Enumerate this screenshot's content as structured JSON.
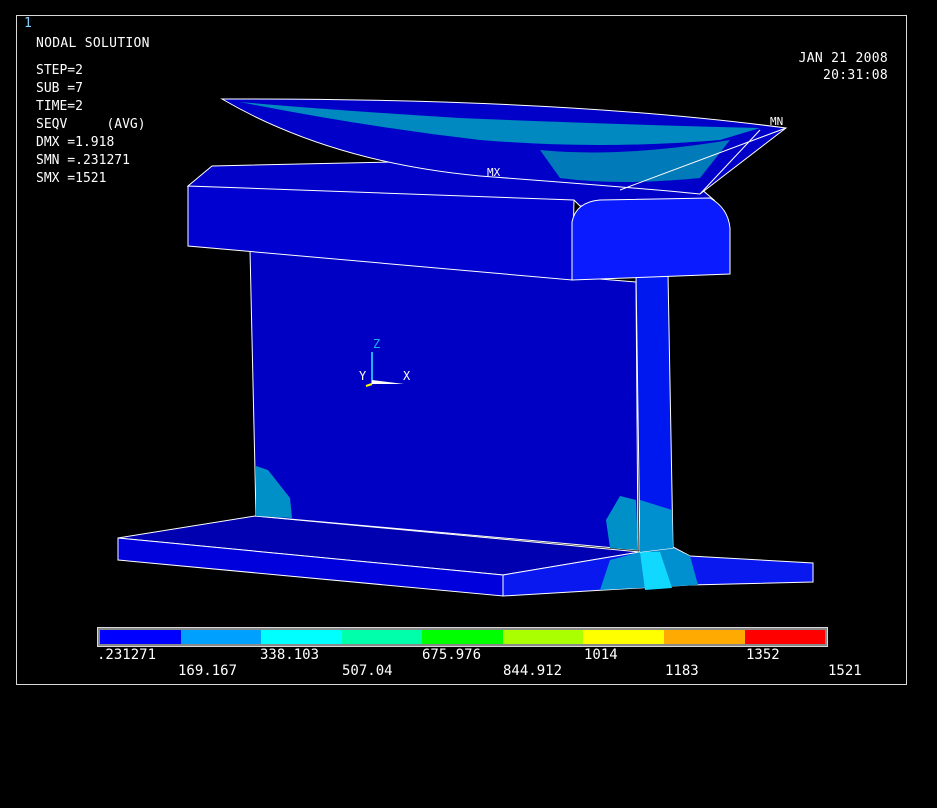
{
  "window_number": "1",
  "title": "NODAL SOLUTION",
  "info_lines": [
    "STEP=2",
    "SUB =7",
    "TIME=2",
    "SEQV     (AVG)",
    "DMX =1.918",
    "SMN =.231271",
    "SMX =1521"
  ],
  "date": "JAN 21 2008",
  "time": "20:31:08",
  "markers": {
    "min": "MN",
    "max": "MX"
  },
  "axes": {
    "z": "Z",
    "y": "Y",
    "x": "X"
  },
  "legend": {
    "colors": [
      "#0000ff",
      "#00a0ff",
      "#00ffff",
      "#00ffaa",
      "#00ff00",
      "#aaff00",
      "#ffff00",
      "#ffaa00",
      "#ff0000"
    ],
    "labels_top": [
      ".231271",
      "338.103",
      "675.976",
      "1014",
      "1352"
    ],
    "labels_bottom": [
      "169.167",
      "507.04",
      "844.912",
      "1183",
      "1521"
    ]
  },
  "colors": {
    "rail_body": "#0000d8",
    "rail_dark": "#0000b4",
    "rail_light": "#0a14ff",
    "stress_mid": "#0088c8",
    "stress_cyan": "#10d0ff",
    "edge": "#ffffff"
  }
}
